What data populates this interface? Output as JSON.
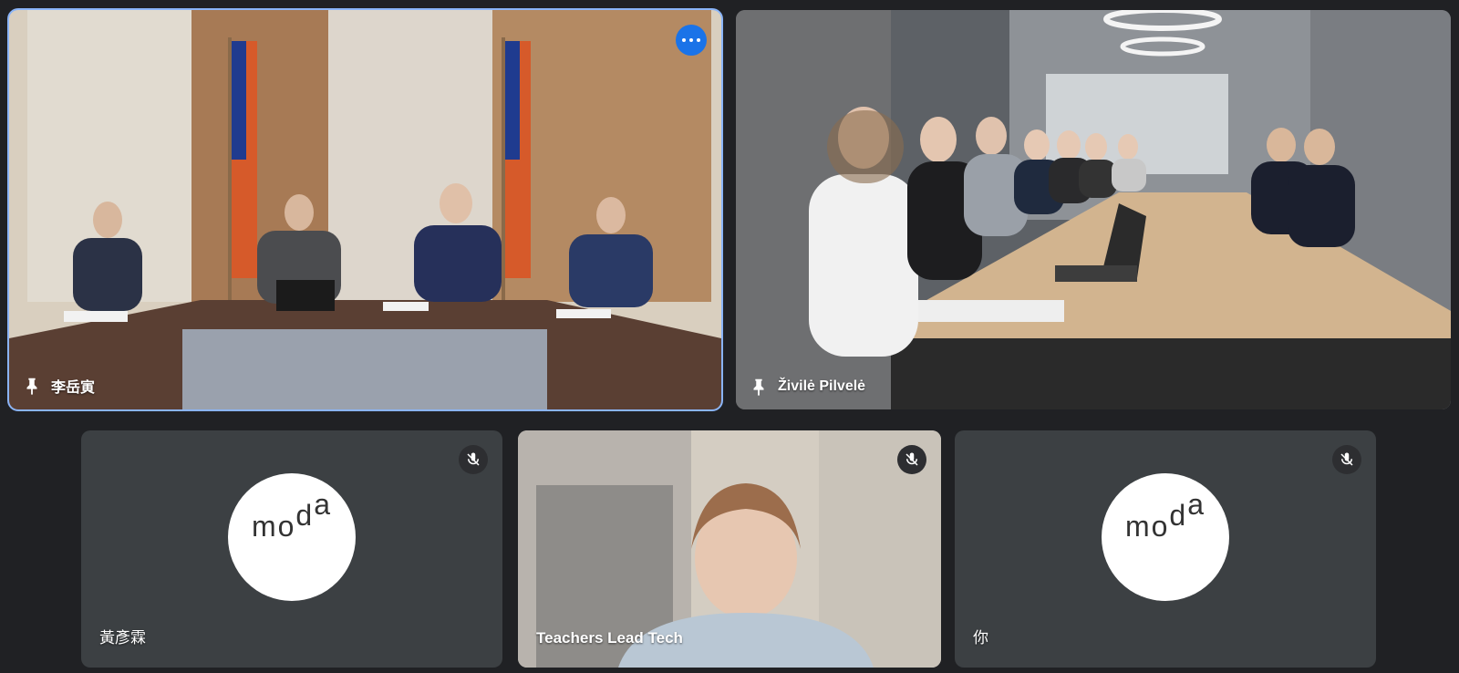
{
  "participants": [
    {
      "name": "李岳寅",
      "pinned": true,
      "active_speaker": true,
      "has_more_menu": true
    },
    {
      "name": "Živilė Pilvelė",
      "pinned": true
    },
    {
      "name": "黃彥霖",
      "muted": true,
      "avatar_text": "moda",
      "avatar_letters": [
        "m",
        "o",
        "d",
        "a"
      ]
    },
    {
      "name": "Teachers Lead Tech",
      "muted": true
    },
    {
      "name": "你",
      "muted": true,
      "avatar_text": "moda",
      "avatar_letters": [
        "m",
        "o",
        "d",
        "a"
      ]
    }
  ],
  "colors": {
    "background": "#202124",
    "tile_bg": "#3c4043",
    "active_outline": "#8ab4f8",
    "more_button": "#1a73e8"
  },
  "icons": {
    "pin": "pin-icon",
    "more": "more-options-icon",
    "mute": "mic-off-icon"
  }
}
